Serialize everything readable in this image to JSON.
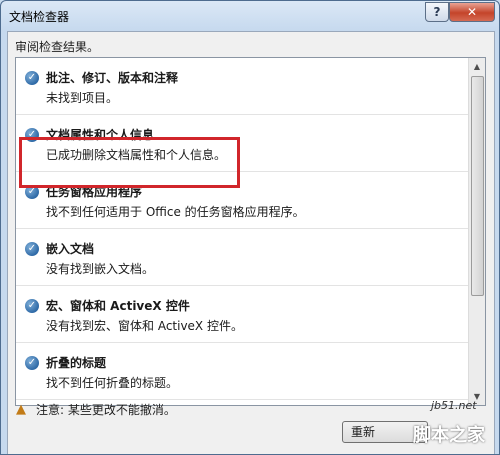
{
  "window": {
    "title": "文档检查器"
  },
  "titlebar": {
    "help": "?",
    "close": "✕"
  },
  "subtitle": "审阅检查结果。",
  "results": [
    {
      "title": "批注、修订、版本和注释",
      "desc": "未找到项目。"
    },
    {
      "title": "文档属性和个人信息",
      "desc": "已成功删除文档属性和个人信息。"
    },
    {
      "title": "任务窗格应用程序",
      "desc": "找不到任何适用于 Office 的任务窗格应用程序。"
    },
    {
      "title": "嵌入文档",
      "desc": "没有找到嵌入文档。"
    },
    {
      "title": "宏、窗体和 ActiveX 控件",
      "desc": "没有找到宏、窗体和 ActiveX 控件。"
    },
    {
      "title": "折叠的标题",
      "desc": "找不到任何折叠的标题。"
    }
  ],
  "note": "注意: 某些更改不能撤消。",
  "buttons": {
    "reinspect": "重新"
  },
  "watermark": {
    "site": "jb51.net",
    "brand": "脚本之家"
  },
  "colors": {
    "highlight": "#d1262b",
    "check": "#2f6aa7"
  }
}
